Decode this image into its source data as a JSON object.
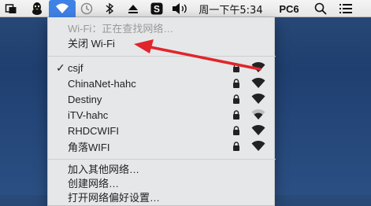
{
  "menubar": {
    "icons": [
      "window-icon",
      "qq-penguin-icon",
      "wifi-icon",
      "time-machine-icon",
      "bluetooth-icon",
      "eject-icon",
      "s-app-icon",
      "volume-icon",
      "search-icon",
      "list-icon"
    ],
    "clock": "周一下午5:34",
    "user": "PC6"
  },
  "wifi_menu": {
    "status": "Wi-Fi：正在查找网络…",
    "toggle_label": "关闭 Wi-Fi",
    "networks": [
      {
        "name": "csjf",
        "connected": true,
        "locked": true,
        "signal": 3
      },
      {
        "name": "ChinaNet-hahc",
        "connected": false,
        "locked": true,
        "signal": 3
      },
      {
        "name": "Destiny",
        "connected": false,
        "locked": true,
        "signal": 3
      },
      {
        "name": "iTV-hahc",
        "connected": false,
        "locked": true,
        "signal": 2
      },
      {
        "name": "RHDCWIFI",
        "connected": false,
        "locked": true,
        "signal": 3
      },
      {
        "name": "角落WIFI",
        "connected": false,
        "locked": true,
        "signal": 3
      }
    ],
    "join_other": "加入其他网络…",
    "create_network": "创建网络…",
    "open_prefs": "打开网络偏好设置…"
  },
  "colors": {
    "highlight": "#3f82e6",
    "arrow": "#e0252b"
  }
}
